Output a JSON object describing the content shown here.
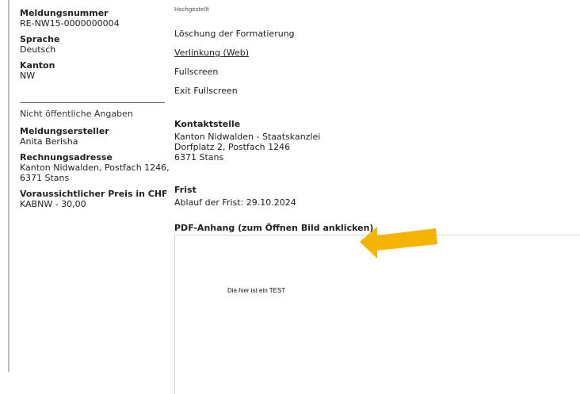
{
  "left": {
    "fields": [
      {
        "label": "Meldungsnummer",
        "value": "RE-NW15-0000000004"
      },
      {
        "label": "Sprache",
        "value": "Deutsch"
      },
      {
        "label": "Kanton",
        "value": "NW"
      }
    ],
    "section_title": "Nicht öffentliche Angaben",
    "private_fields": [
      {
        "label": "Meldungsersteller",
        "value": "Anita Berisha"
      },
      {
        "label": "Rechnungsadresse",
        "value": "Kanton Nidwalden, Postfach 1246, 6371 Stans"
      },
      {
        "label": "Voraussichtlicher Preis in CHF",
        "value": "KABNW - 30,00"
      }
    ]
  },
  "main": {
    "top_small": "Hochgestellt",
    "menu": [
      "Löschung der Formatierung",
      "Verlinkung (Web)",
      "Fullscreen",
      "Exit Fullscreen"
    ],
    "contact": {
      "title": "Kontaktstelle",
      "lines": [
        "Kanton Nidwalden - Staatskanzlei",
        "Dorfplatz 2, Postfach 1246",
        "6371 Stans"
      ]
    },
    "deadline": {
      "title": "Frist",
      "text": "Ablauf der Frist: 29.10.2024"
    },
    "pdf": {
      "title": "PDF-Anhang (zum Öffnen Bild anklicken)",
      "preview_text": "Die hier ist ein TEST"
    }
  },
  "colors": {
    "arrow": "#f5b400",
    "divider": "#bdbdbd"
  }
}
